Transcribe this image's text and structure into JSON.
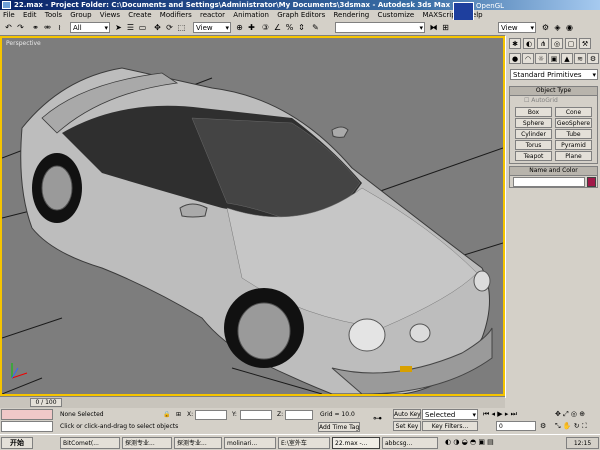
{
  "window": {
    "title": "22.max  - Project Folder: C:\\Documents and Settings\\Administrator\\My Documents\\3dsmax  - Autodesk 3ds Max 9"
  },
  "menu": [
    "File",
    "Edit",
    "Tools",
    "Group",
    "Views",
    "Create",
    "Modifiers",
    "reactor",
    "Animation",
    "Graph Editors",
    "Rendering",
    "Customize",
    "MAXScript",
    "Help"
  ],
  "toolbar": {
    "selection_filter": "All",
    "ref_coord": "View",
    "ref_coord2": "View",
    "renderer_label": "OpenGL"
  },
  "viewport": {
    "label": "Perspective"
  },
  "command_panel": {
    "category": "Standard Primitives",
    "object_type_title": "Object Type",
    "autogrid": "AutoGrid",
    "buttons": [
      "Box",
      "Cone",
      "Sphere",
      "GeoSphere",
      "Cylinder",
      "Tube",
      "Torus",
      "Pyramid",
      "Teapot",
      "Plane"
    ],
    "name_color_title": "Name and Color",
    "color_swatch": "#a01848"
  },
  "timeline": {
    "frame": "0 / 100"
  },
  "status": {
    "selection": "None Selected",
    "prompt": "Click or click-and-drag to select objects",
    "x_label": "X:",
    "y_label": "Y:",
    "z_label": "Z:",
    "grid": "Grid = 10.0",
    "add_time_tag": "Add Time Tag",
    "auto_key": "Auto Key",
    "set_key": "Set Key",
    "key_mode": "Selected",
    "key_filters": "Key Filters...",
    "current_frame": "0"
  },
  "taskbar": {
    "start": "开始",
    "tasks": [
      "BitComet(...",
      "探测专业...",
      "探测专业...",
      "molinari...",
      "E:\\室外车",
      "22.max -...",
      "abbcsg..."
    ],
    "clock": "12:15"
  }
}
